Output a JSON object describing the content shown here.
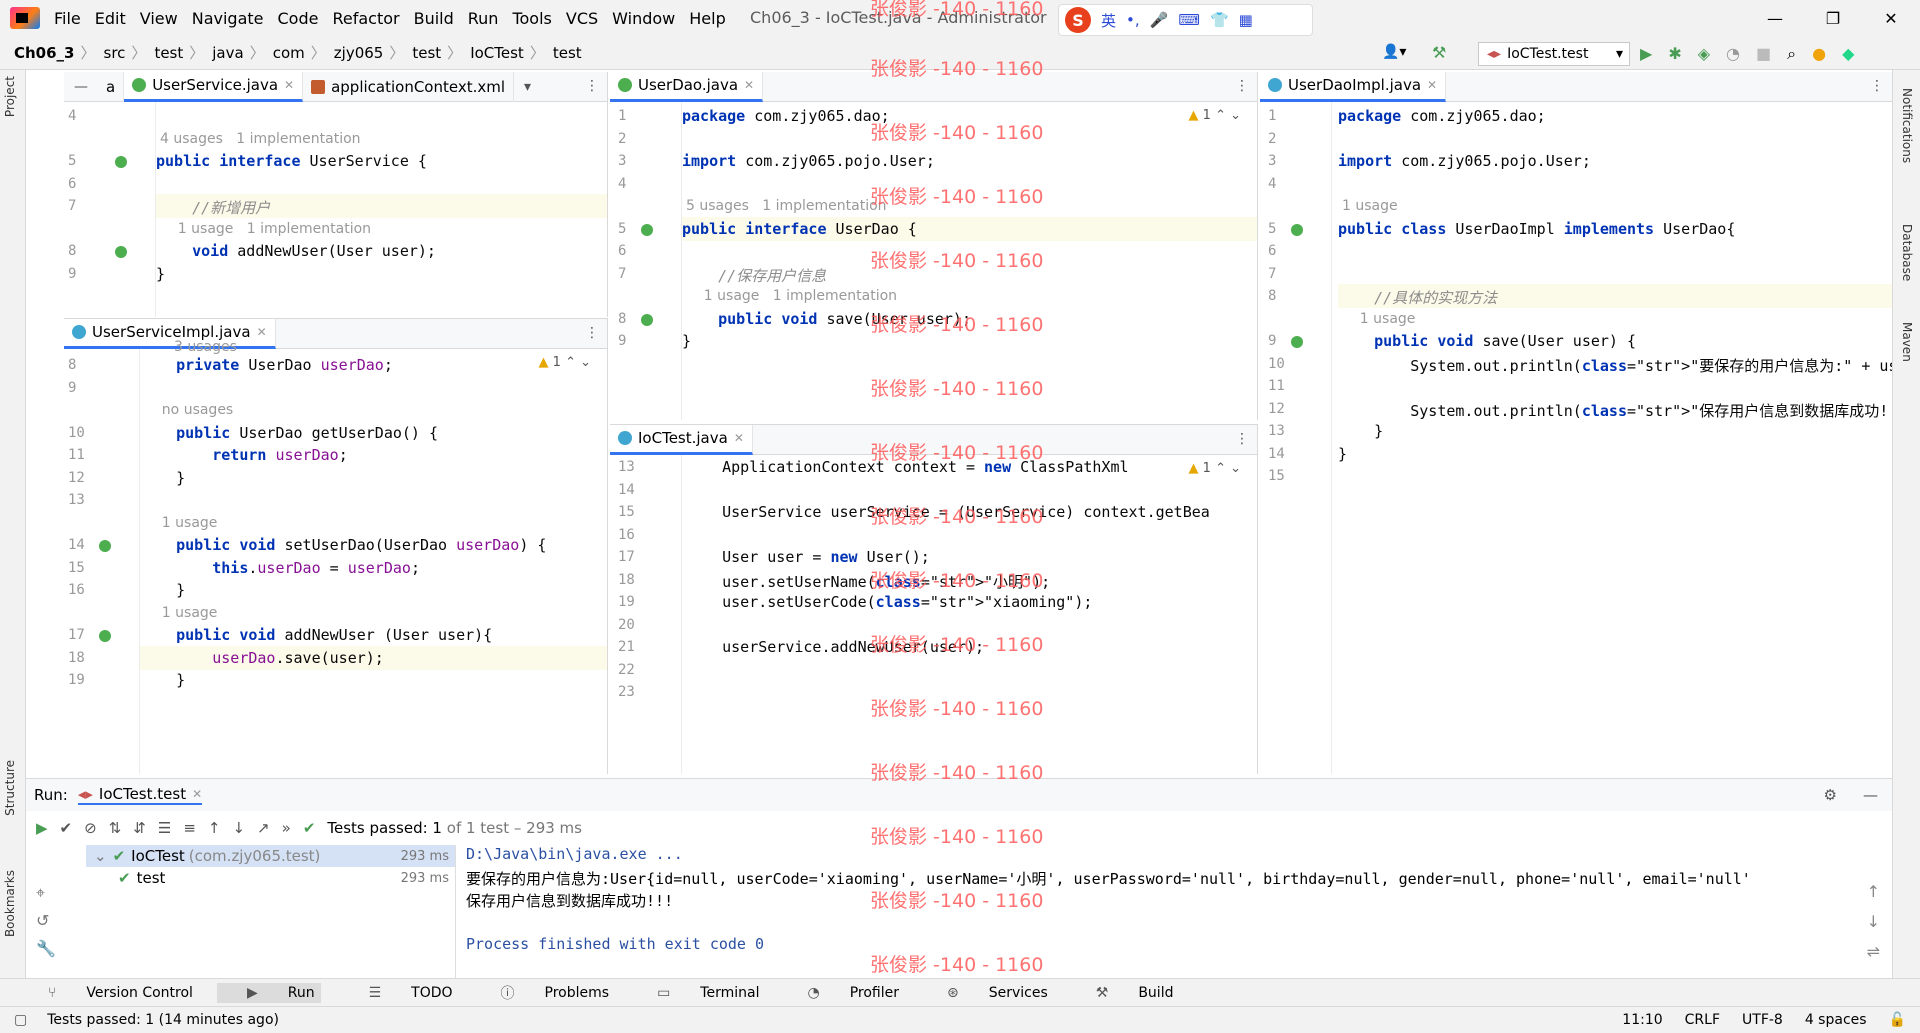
{
  "menubar": {
    "items": [
      "File",
      "Edit",
      "View",
      "Navigate",
      "Code",
      "Refactor",
      "Build",
      "Run",
      "Tools",
      "VCS",
      "Window",
      "Help"
    ],
    "title": "Ch06_3 - IoCTest.java - Administrator",
    "ime_label": "英"
  },
  "breadcrumb": [
    "Ch06_3",
    "src",
    "test",
    "java",
    "com",
    "zjy065",
    "test",
    "IoCTest",
    "test"
  ],
  "run_config": "IoCTest.test",
  "watermark": "张俊影 -140 - 1160",
  "left_tabs": [
    "Project",
    "Structure",
    "Bookmarks"
  ],
  "right_tabs": [
    "Notifications",
    "Database",
    "Maven"
  ],
  "pane_a": {
    "tabs": [
      "a",
      "UserService.java",
      "applicationContext.xml"
    ],
    "lines": [
      {
        "n": "4",
        "t": ""
      },
      {
        "hint": "4 usages   1 implementation"
      },
      {
        "n": "5",
        "t": "public interface UserService {"
      },
      {
        "n": "6",
        "t": ""
      },
      {
        "n": "7",
        "t": "    //新增用户"
      },
      {
        "hint": "    1 usage   1 implementation"
      },
      {
        "n": "8",
        "t": "    void addNewUser(User user);"
      },
      {
        "n": "9",
        "t": "}"
      }
    ]
  },
  "pane_b": {
    "tabs": [
      "UserServiceImpl.java"
    ],
    "hint_top": "3 usages",
    "warn": "1",
    "lines": [
      {
        "n": "8",
        "t": "    private UserDao userDao;"
      },
      {
        "n": "9",
        "t": ""
      },
      {
        "hint": "    no usages"
      },
      {
        "n": "10",
        "t": "    public UserDao getUserDao() {"
      },
      {
        "n": "11",
        "t": "        return userDao;"
      },
      {
        "n": "12",
        "t": "    }"
      },
      {
        "n": "13",
        "t": ""
      },
      {
        "hint": "    1 usage"
      },
      {
        "n": "14",
        "t": "    public void setUserDao(UserDao userDao) {"
      },
      {
        "n": "15",
        "t": "        this.userDao = userDao;"
      },
      {
        "n": "16",
        "t": "    }"
      },
      {
        "hint": "    1 usage"
      },
      {
        "n": "17",
        "t": "    public void addNewUser (User user){"
      },
      {
        "n": "18",
        "t": "        userDao.save(user);"
      },
      {
        "n": "19",
        "t": "    }"
      }
    ]
  },
  "pane_c": {
    "tabs": [
      "UserDao.java"
    ],
    "warn": "1",
    "lines": [
      {
        "n": "1",
        "t": "package com.zjy065.dao;"
      },
      {
        "n": "2",
        "t": ""
      },
      {
        "n": "3",
        "t": "import com.zjy065.pojo.User;"
      },
      {
        "n": "4",
        "t": ""
      },
      {
        "hint": "5 usages   1 implementation"
      },
      {
        "n": "5",
        "t": "public interface UserDao {"
      },
      {
        "n": "6",
        "t": ""
      },
      {
        "n": "7",
        "t": "    //保存用户信息"
      },
      {
        "hint": "    1 usage   1 implementation"
      },
      {
        "n": "8",
        "t": "    public void save(User user);"
      },
      {
        "n": "9",
        "t": "}"
      }
    ]
  },
  "pane_d": {
    "tabs": [
      "IoCTest.java"
    ],
    "warn": "1",
    "lines": [
      {
        "n": "13",
        "t": "    ApplicationContext context = new ClassPathXml"
      },
      {
        "n": "14",
        "t": ""
      },
      {
        "n": "15",
        "t": "    UserService userService = (UserService) context.getBea"
      },
      {
        "n": "16",
        "t": ""
      },
      {
        "n": "17",
        "t": "    User user = new User();"
      },
      {
        "n": "18",
        "t": "    user.setUserName(\"小明\");"
      },
      {
        "n": "19",
        "t": "    user.setUserCode(\"xiaoming\");"
      },
      {
        "n": "20",
        "t": ""
      },
      {
        "n": "21",
        "t": "    userService.addNewUser(user);"
      },
      {
        "n": "22",
        "t": ""
      },
      {
        "n": "23",
        "t": ""
      }
    ]
  },
  "pane_e": {
    "tabs": [
      "UserDaoImpl.java"
    ],
    "lines": [
      {
        "n": "1",
        "t": "package com.zjy065.dao;"
      },
      {
        "n": "2",
        "t": ""
      },
      {
        "n": "3",
        "t": "import com.zjy065.pojo.User;"
      },
      {
        "n": "4",
        "t": ""
      },
      {
        "hint": "1 usage"
      },
      {
        "n": "5",
        "t": "public class UserDaoImpl implements UserDao{"
      },
      {
        "n": "6",
        "t": ""
      },
      {
        "n": "7",
        "t": ""
      },
      {
        "n": "8",
        "t": "    //具体的实现方法"
      },
      {
        "hint": "    1 usage"
      },
      {
        "n": "9",
        "t": "    public void save(User user) {"
      },
      {
        "n": "10",
        "t": "        System.out.println(\"要保存的用户信息为:\" + user);"
      },
      {
        "n": "11",
        "t": ""
      },
      {
        "n": "12",
        "t": "        System.out.println(\"保存用户信息到数据库成功!!!\");"
      },
      {
        "n": "13",
        "t": "    }"
      },
      {
        "n": "14",
        "t": "}"
      },
      {
        "n": "15",
        "t": ""
      }
    ]
  },
  "run": {
    "label": "Run:",
    "tab": "IoCTest.test",
    "status": "Tests passed: 1",
    "status_detail": "of 1 test – 293 ms",
    "tree": [
      {
        "name": "IoCTest",
        "pkg": "(com.zjy065.test)",
        "time": "293 ms"
      },
      {
        "name": "test",
        "pkg": "",
        "time": "293 ms"
      }
    ],
    "console": [
      "D:\\Java\\bin\\java.exe ...",
      "要保存的用户信息为:User{id=null, userCode='xiaoming', userName='小明', userPassword='null', birthday=null, gender=null, phone='null', email='null'",
      "保存用户信息到数据库成功!!!",
      "",
      "Process finished with exit code 0"
    ]
  },
  "bottom_tabs": [
    "Version Control",
    "Run",
    "TODO",
    "Problems",
    "Terminal",
    "Profiler",
    "Services",
    "Build"
  ],
  "statusbar": {
    "message": "Tests passed: 1 (14 minutes ago)",
    "pos": "11:10",
    "eol": "CRLF",
    "enc": "UTF-8",
    "indent": "4 spaces"
  }
}
